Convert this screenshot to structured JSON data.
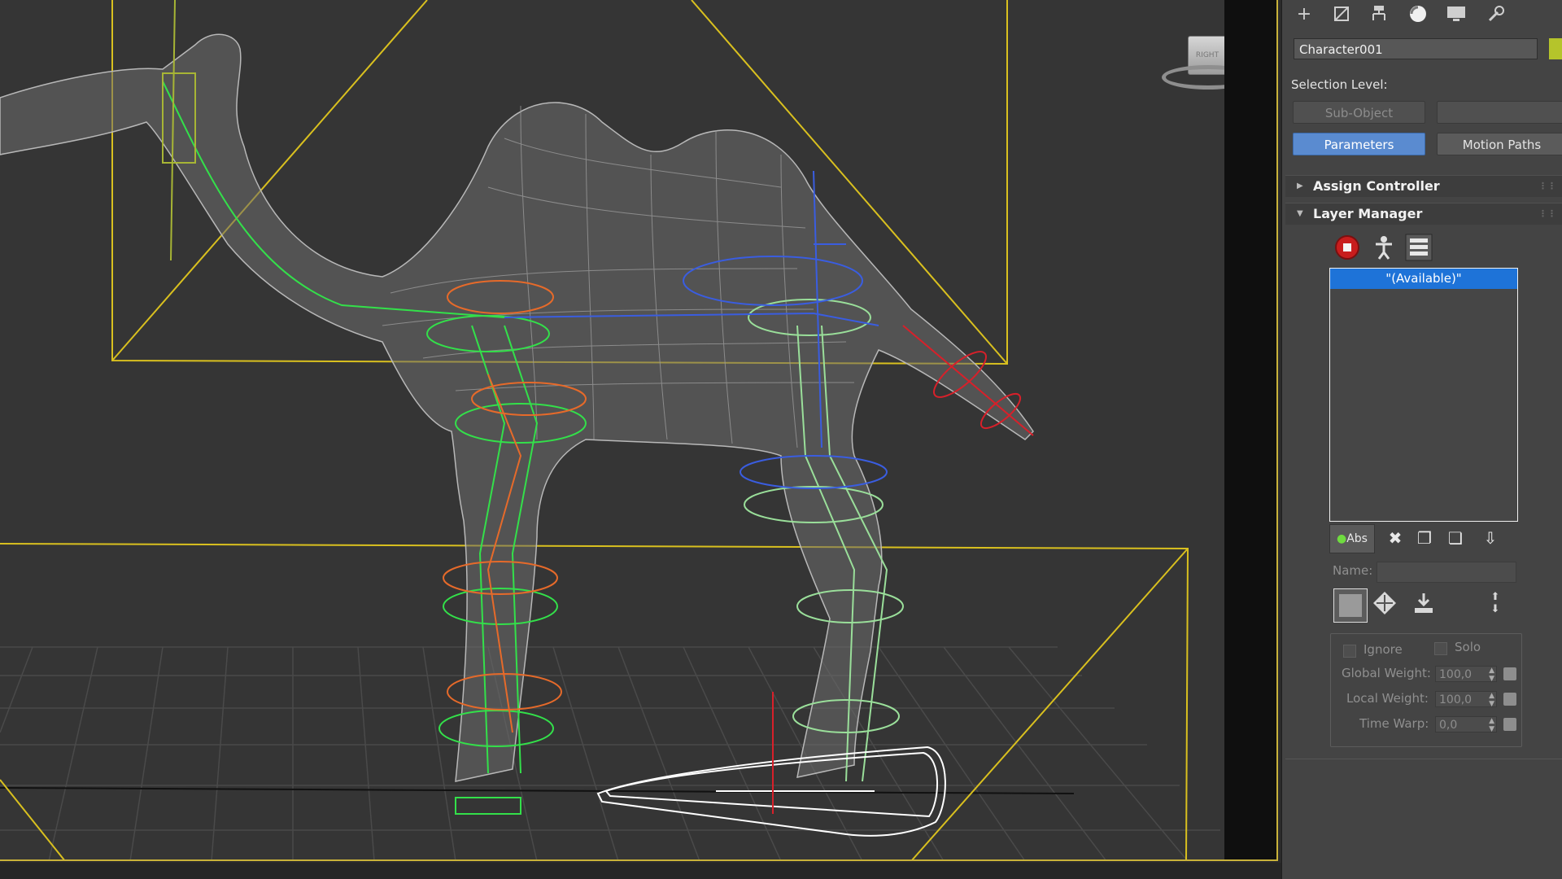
{
  "viewport": {
    "viewcube_face": "RIGHT",
    "object_color": "#b5c42b",
    "bounding_box_color": "#d9c01f"
  },
  "panel": {
    "tabs": [
      {
        "name": "create",
        "icon": "plus-icon"
      },
      {
        "name": "modify",
        "icon": "modify-icon"
      },
      {
        "name": "hierarchy",
        "icon": "hierarchy-icon"
      },
      {
        "name": "motion",
        "icon": "motion-icon",
        "active": true
      },
      {
        "name": "display",
        "icon": "display-icon"
      },
      {
        "name": "utilities",
        "icon": "wrench-icon"
      }
    ],
    "object_name": "Character001",
    "selection_level_label": "Selection Level:",
    "sub_object_label": "Sub-Object",
    "parameters_label": "Parameters",
    "motion_paths_label": "Motion Paths",
    "assign_controller_title": "Assign Controller",
    "layer_manager_title": "Layer Manager",
    "layers": [
      "\"(Available)\""
    ],
    "abs_label": "Abs",
    "name_label": "Name:",
    "ignore_label": "Ignore",
    "solo_label": "Solo",
    "global_weight_label": "Global Weight:",
    "global_weight_value": "100,0",
    "local_weight_label": "Local Weight:",
    "local_weight_value": "100,0",
    "time_warp_label": "Time Warp:",
    "time_warp_value": "0,0"
  }
}
